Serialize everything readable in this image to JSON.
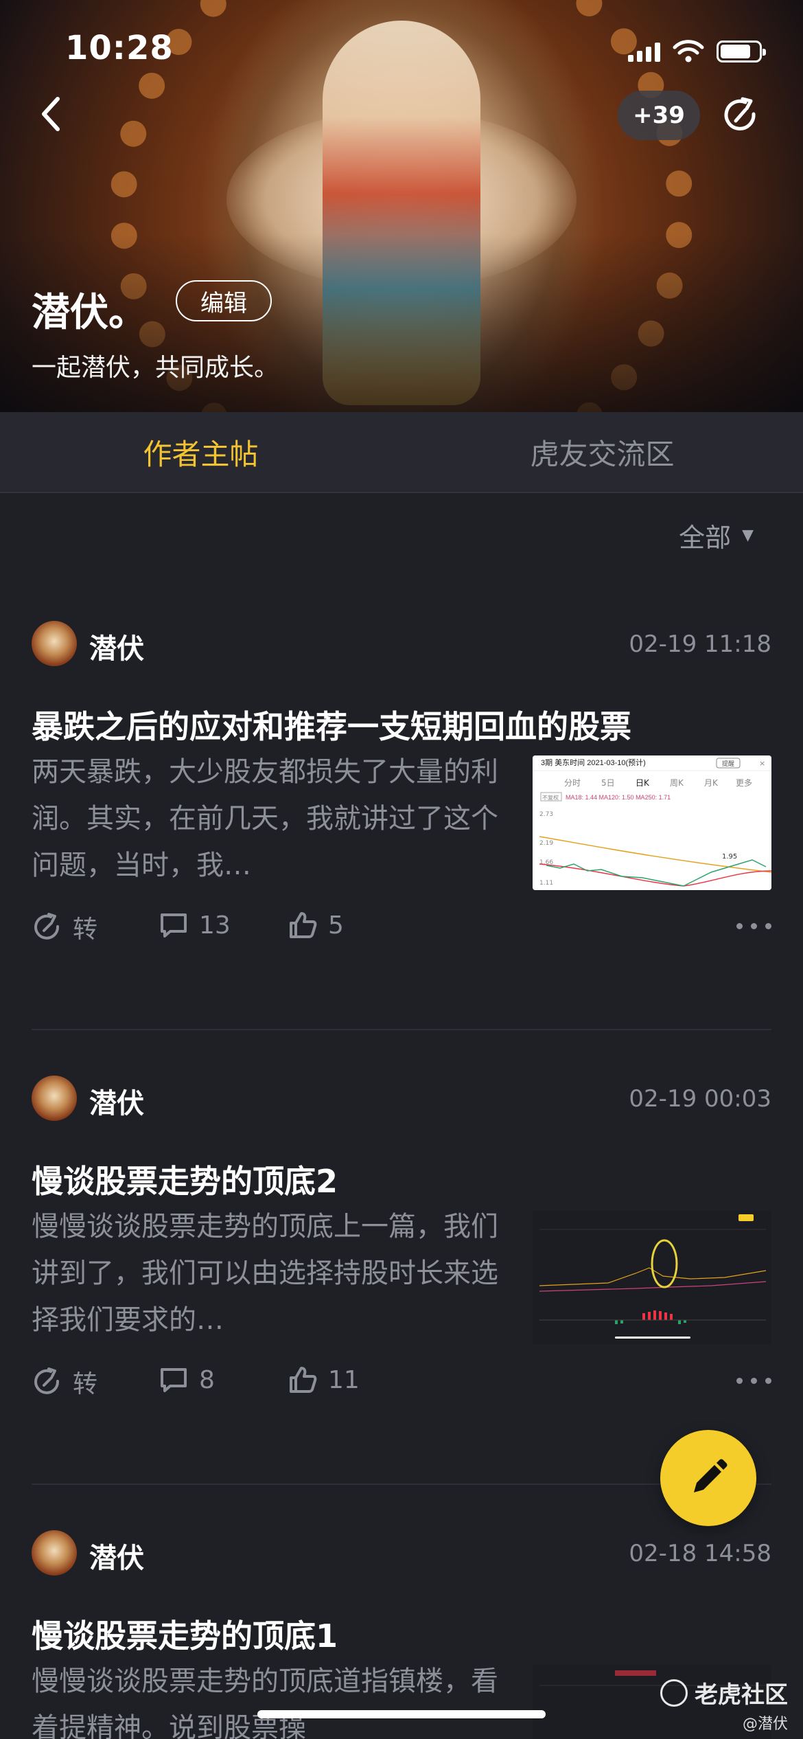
{
  "status_bar": {
    "time": "10:28"
  },
  "header": {
    "count_badge": "+39",
    "profile_name": "潜伏。",
    "edit_label": "编辑",
    "bio": "一起潜伏，共同成长。"
  },
  "tabs": [
    {
      "label": "作者主帖",
      "active": true
    },
    {
      "label": "虎友交流区",
      "active": false
    }
  ],
  "filter": {
    "label": "全部"
  },
  "posts": [
    {
      "author": "潜伏",
      "time": "02-19 11:18",
      "title": "暴跌之后的应对和推荐一支短期回血的股票",
      "excerpt": "两天暴跌，大少股友都损失了大量的利润。其实，在前几天，我就讲过了这个问题，当时，我…",
      "repost_label": "转",
      "comments": "13",
      "likes": "5",
      "thumb": {
        "header": "3期 美东时间 2021-03-10(预计)",
        "tabs": [
          "分时",
          "5日",
          "日K",
          "周K",
          "月K",
          "更多"
        ],
        "ma": "MA18: 1.44  MA120: 1.50  MA250: 1.71",
        "tag": "不复权",
        "levels": [
          "2.73",
          "2.19",
          "1.66",
          "1.11"
        ],
        "mark": "1.95"
      }
    },
    {
      "author": "潜伏",
      "time": "02-19 00:03",
      "title": "慢谈股票走势的顶底2",
      "excerpt": "慢慢谈谈股票走势的顶底上一篇，我们讲到了，我们可以由选择持股时长来选择我们要求的…",
      "repost_label": "转",
      "comments": "8",
      "likes": "11"
    },
    {
      "author": "潜伏",
      "time": "02-18 14:58",
      "title": "慢谈股票走势的顶底1",
      "excerpt": "慢慢谈谈股票走势的顶底道指镇楼，看着提精神。说到股票操"
    }
  ],
  "watermark": {
    "brand": "老虎社区",
    "user": "@潜伏"
  },
  "colors": {
    "accent": "#f3c331",
    "fab": "#f4cd2a",
    "background": "#1f2026"
  }
}
